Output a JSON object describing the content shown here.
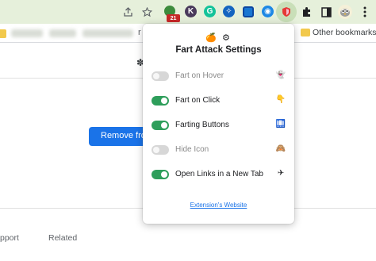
{
  "toolbar": {
    "share_icon": "share-icon",
    "star_icon": "star-icon",
    "extensions": [
      {
        "name": "green-extension-icon",
        "color": "#3d8b3d",
        "glyph": "G"
      },
      {
        "name": "k-extension-icon",
        "color": "#4a3b5c",
        "glyph": "K"
      },
      {
        "name": "grammarly-icon",
        "color": "#15c39a",
        "glyph": "G"
      },
      {
        "name": "blue-extension-icon",
        "color": "#1565c0",
        "glyph": "✧"
      },
      {
        "name": "edit-extension-icon",
        "color": "#1976d2",
        "glyph": "◩"
      },
      {
        "name": "shield-extension-icon",
        "color": "#1e88e5",
        "glyph": "◉"
      },
      {
        "name": "fart-attack-extension-icon",
        "color": "#e53935",
        "glyph": "♥"
      }
    ],
    "badge_count": "21",
    "puzzle_icon": "puzzle-icon",
    "sidepanel_icon": "sidepanel-icon",
    "profile_icon": "profile-avatar-icon",
    "menu_icon": "kebab-menu-icon"
  },
  "bookmarks": {
    "fragment": "r",
    "other_bookmarks": "Other bookmarks"
  },
  "page": {
    "remove_button": "Remove fro",
    "tab_support": "pport",
    "tab_related": "Related"
  },
  "popup": {
    "logos": "🍊 ⚙",
    "title": "Fart Attack Settings",
    "settings": [
      {
        "label": "Fart on Hover",
        "enabled": false,
        "emoji": "👻"
      },
      {
        "label": "Fart on Click",
        "enabled": true,
        "emoji": "👇"
      },
      {
        "label": "Farting Buttons",
        "enabled": true,
        "emoji": "🛄"
      },
      {
        "label": "Hide Icon",
        "enabled": false,
        "emoji": "🙈"
      },
      {
        "label": "Open Links in a New Tab",
        "enabled": true,
        "emoji": "✈"
      }
    ],
    "website_link": "Extension's Website"
  },
  "colors": {
    "toolbar_bg": "#e6f0db",
    "toggle_on": "#2e9e5b",
    "toggle_off": "#d7d7d7",
    "primary_button": "#1a73e8"
  }
}
